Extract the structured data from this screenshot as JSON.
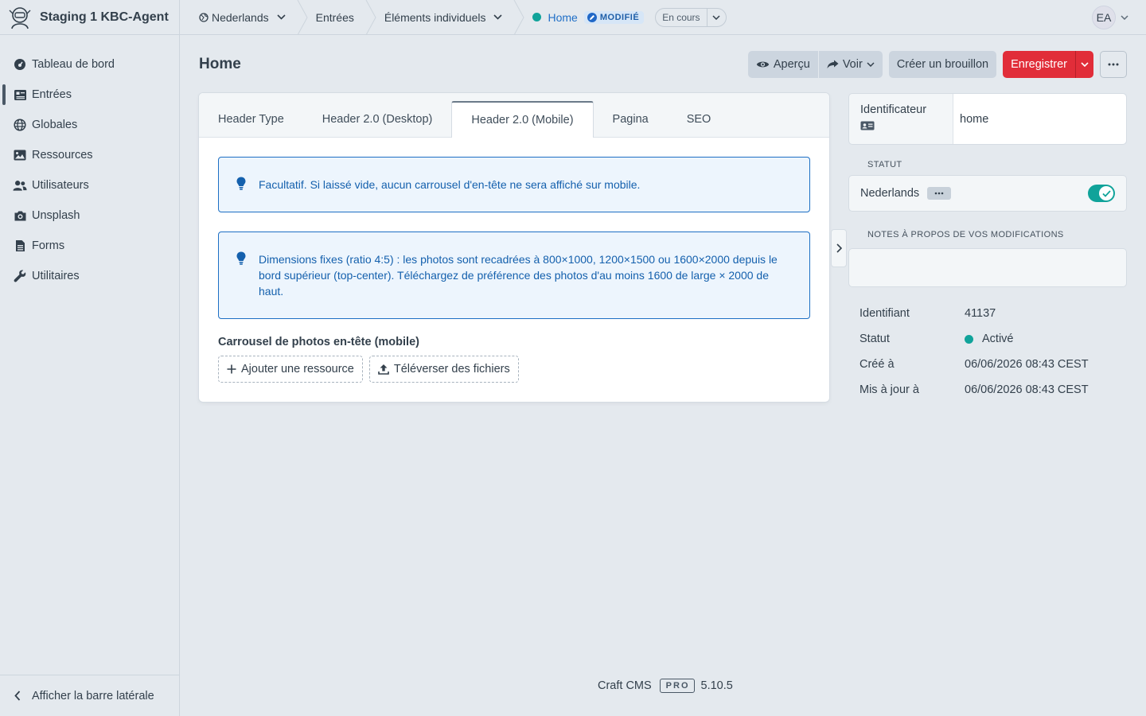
{
  "site": {
    "name": "Staging 1 KBC-Agent"
  },
  "sidebar": {
    "items": [
      {
        "label": "Tableau de bord",
        "icon": "dashboard-icon"
      },
      {
        "label": "Entrées",
        "icon": "newspaper-icon",
        "active": true
      },
      {
        "label": "Globales",
        "icon": "globe-icon"
      },
      {
        "label": "Ressources",
        "icon": "image-icon"
      },
      {
        "label": "Utilisateurs",
        "icon": "users-icon"
      },
      {
        "label": "Unsplash",
        "icon": "camera-icon"
      },
      {
        "label": "Forms",
        "icon": "document-icon"
      },
      {
        "label": "Utilitaires",
        "icon": "wrench-icon"
      }
    ],
    "toggle_label": "Afficher la barre latérale"
  },
  "topbar": {
    "site": "Nederlands",
    "section": "Entrées",
    "subsection": "Éléments individuels",
    "current": "Home",
    "badge": "MODIFIÉ",
    "draft_status": "En cours",
    "user_initials": "EA"
  },
  "page": {
    "title": "Home",
    "preview_label": "Aperçu",
    "view_label": "Voir",
    "draft_label": "Créer un brouillon",
    "save_label": "Enregistrer"
  },
  "tabs": [
    "Header Type",
    "Header 2.0 (Desktop)",
    "Header 2.0 (Mobile)",
    "Pagina",
    "SEO"
  ],
  "active_tab": 2,
  "content": {
    "tip1": "Facultatif. Si laissé vide, aucun carrousel d'en-tête ne sera affiché sur mobile.",
    "tip2": "Dimensions fixes (ratio 4:5) : les photos sont recadrées à 800×1000, 1200×1500 ou 1600×2000 depuis le bord supérieur (top-center). Téléchargez de préférence des photos d'au moins 1600 de large × 2000 de haut.",
    "field_label": "Carrousel de photos en-tête (mobile)",
    "add_asset_label": "Ajouter une ressource",
    "upload_label": "Téléverser des fichiers"
  },
  "details": {
    "slug_label": "Identificateur",
    "slug_value": "home",
    "status_heading": "STATUT",
    "status_site": "Nederlands",
    "status_enabled": true,
    "notes_heading": "NOTES À PROPOS DE VOS MODIFICATIONS",
    "meta": [
      {
        "label": "Identifiant",
        "value": "41137"
      },
      {
        "label": "Statut",
        "value": "Activé"
      },
      {
        "label": "Créé à",
        "value": "06/06/2026 08:43 CEST"
      },
      {
        "label": "Mis à jour à",
        "value": "06/06/2026 08:43 CEST"
      }
    ]
  },
  "footer": {
    "product": "Craft CMS",
    "edition": "PRO",
    "version": "5.10.5"
  },
  "colors": {
    "accent_red": "#e12d39",
    "status_green": "#10a39a",
    "link_blue": "#1f6fc7"
  }
}
